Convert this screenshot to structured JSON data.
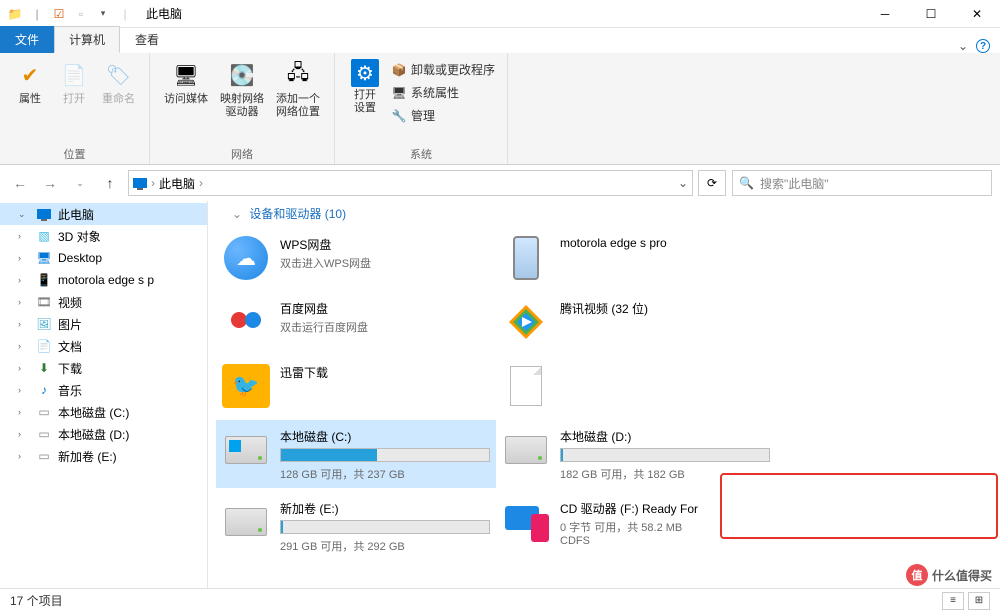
{
  "window": {
    "title": "此电脑"
  },
  "tabs": {
    "file": "文件",
    "computer": "计算机",
    "view": "查看"
  },
  "ribbon": {
    "location": {
      "label": "位置",
      "props": "属性",
      "open": "打开",
      "rename": "重命名"
    },
    "network": {
      "label": "网络",
      "media": "访问媒体",
      "mapdrive": "映射网络\n驱动器",
      "addloc": "添加一个\n网络位置"
    },
    "system": {
      "label": "系统",
      "opensettings": "打开\n设置",
      "uninstall": "卸载或更改程序",
      "props": "系统属性",
      "manage": "管理"
    }
  },
  "address": {
    "root": "此电脑",
    "chevron": "›",
    "dropdown": "⌄",
    "refresh": "⟳"
  },
  "search": {
    "placeholder": "搜索\"此电脑\""
  },
  "nav": {
    "items": [
      {
        "label": "此电脑",
        "icon": "monitor",
        "selected": true,
        "expand": "⌄"
      },
      {
        "label": "3D 对象",
        "icon": "cube"
      },
      {
        "label": "Desktop",
        "icon": "monitor2"
      },
      {
        "label": "motorola edge s p",
        "icon": "phone"
      },
      {
        "label": "视频",
        "icon": "video"
      },
      {
        "label": "图片",
        "icon": "pic"
      },
      {
        "label": "文档",
        "icon": "doc"
      },
      {
        "label": "下载",
        "icon": "dl"
      },
      {
        "label": "音乐",
        "icon": "music"
      },
      {
        "label": "本地磁盘 (C:)",
        "icon": "drive"
      },
      {
        "label": "本地磁盘 (D:)",
        "icon": "drive"
      },
      {
        "label": "新加卷 (E:)",
        "icon": "drive"
      }
    ]
  },
  "section_header": "设备和驱动器 (10)",
  "items": [
    {
      "title": "WPS网盘",
      "sub": "双击进入WPS网盘",
      "icon": "wps"
    },
    {
      "title": "motorola edge s pro",
      "sub": "",
      "icon": "phone"
    },
    {
      "title": "百度网盘",
      "sub": "双击运行百度网盘",
      "icon": "baidu"
    },
    {
      "title": "腾讯视频 (32 位)",
      "sub": "",
      "icon": "tencent"
    },
    {
      "title": "迅雷下载",
      "sub": "",
      "icon": "xunlei"
    },
    {
      "title": "",
      "sub": "",
      "icon": "doc"
    },
    {
      "title": "本地磁盘 (C:)",
      "sub": "128 GB 可用，共 237 GB",
      "icon": "drive-win",
      "bar": 46,
      "selected": true
    },
    {
      "title": "本地磁盘 (D:)",
      "sub": "182 GB 可用，共 182 GB",
      "icon": "drive",
      "bar": 1
    },
    {
      "title": "新加卷 (E:)",
      "sub": "291 GB 可用，共 292 GB",
      "icon": "drive",
      "bar": 1
    },
    {
      "title": "CD 驱动器 (F:) Ready For",
      "sub": "0 字节 可用，共 58.2 MB",
      "sub2": "CDFS",
      "icon": "readyfor",
      "highlight": true
    }
  ],
  "status": {
    "count": "17 个项目"
  },
  "watermark": "什么值得买"
}
